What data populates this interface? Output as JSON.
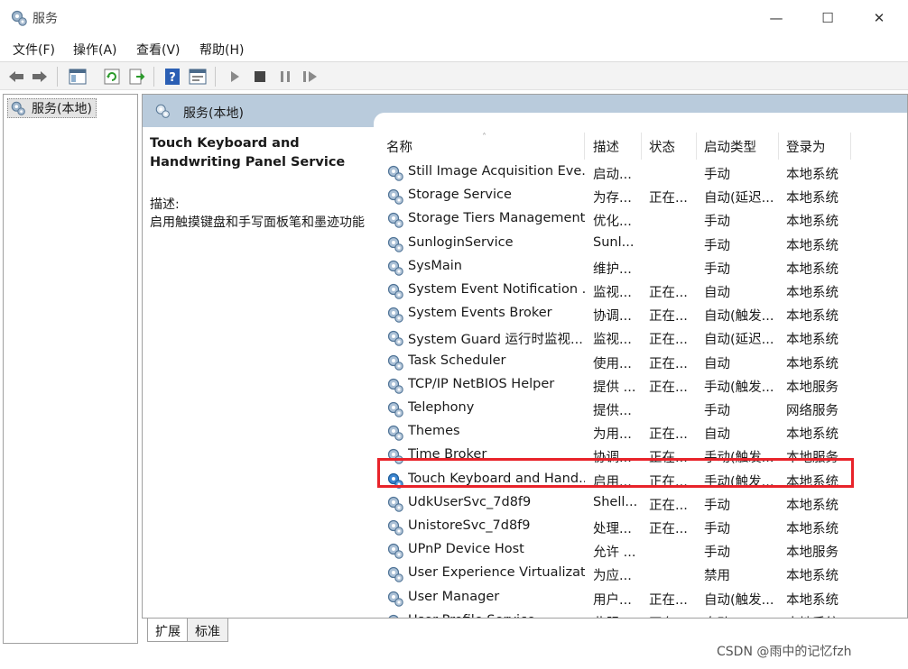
{
  "window": {
    "title": "服务",
    "min_glyph": "—",
    "max_glyph": "☐",
    "close_glyph": "✕"
  },
  "menu": {
    "items": [
      "文件(F)",
      "操作(A)",
      "查看(V)",
      "帮助(H)"
    ]
  },
  "tree": {
    "root_label": "服务(本地)"
  },
  "main": {
    "header_title": "服务(本地)"
  },
  "description": {
    "service_title": "Touch Keyboard and Handwriting Panel Service",
    "label": "描述:",
    "text": "启用触摸键盘和手写面板笔和墨迹功能"
  },
  "columns": [
    "名称",
    "描述",
    "状态",
    "启动类型",
    "登录为"
  ],
  "sort_indicator": "˄",
  "services": [
    {
      "name": "Still Image Acquisition Eve...",
      "desc": "启动...",
      "state": "",
      "startup": "手动",
      "logon": "本地系统"
    },
    {
      "name": "Storage Service",
      "desc": "为存...",
      "state": "正在...",
      "startup": "自动(延迟...",
      "logon": "本地系统"
    },
    {
      "name": "Storage Tiers Management",
      "desc": "优化...",
      "state": "",
      "startup": "手动",
      "logon": "本地系统"
    },
    {
      "name": "SunloginService",
      "desc": "Sunl...",
      "state": "",
      "startup": "手动",
      "logon": "本地系统"
    },
    {
      "name": "SysMain",
      "desc": "维护...",
      "state": "",
      "startup": "手动",
      "logon": "本地系统"
    },
    {
      "name": "System Event Notification ...",
      "desc": "监视...",
      "state": "正在...",
      "startup": "自动",
      "logon": "本地系统"
    },
    {
      "name": "System Events Broker",
      "desc": "协调...",
      "state": "正在...",
      "startup": "自动(触发...",
      "logon": "本地系统"
    },
    {
      "name": "System Guard 运行时监视...",
      "desc": "监视...",
      "state": "正在...",
      "startup": "自动(延迟...",
      "logon": "本地系统"
    },
    {
      "name": "Task Scheduler",
      "desc": "使用...",
      "state": "正在...",
      "startup": "自动",
      "logon": "本地系统"
    },
    {
      "name": "TCP/IP NetBIOS Helper",
      "desc": "提供 ...",
      "state": "正在...",
      "startup": "手动(触发...",
      "logon": "本地服务"
    },
    {
      "name": "Telephony",
      "desc": "提供...",
      "state": "",
      "startup": "手动",
      "logon": "网络服务"
    },
    {
      "name": "Themes",
      "desc": "为用...",
      "state": "正在...",
      "startup": "自动",
      "logon": "本地系统"
    },
    {
      "name": "Time Broker",
      "desc": "协调...",
      "state": "正在...",
      "startup": "手动(触发...",
      "logon": "本地服务"
    },
    {
      "name": "Touch Keyboard and Hand...",
      "desc": "启用...",
      "state": "正在...",
      "startup": "手动(触发...",
      "logon": "本地系统"
    },
    {
      "name": "UdkUserSvc_7d8f9",
      "desc": "Shell...",
      "state": "正在...",
      "startup": "手动",
      "logon": "本地系统"
    },
    {
      "name": "UnistoreSvc_7d8f9",
      "desc": "处理...",
      "state": "正在...",
      "startup": "手动",
      "logon": "本地系统"
    },
    {
      "name": "UPnP Device Host",
      "desc": "允许 ...",
      "state": "",
      "startup": "手动",
      "logon": "本地服务"
    },
    {
      "name": "User Experience Virtualizat...",
      "desc": "为应...",
      "state": "",
      "startup": "禁用",
      "logon": "本地系统"
    },
    {
      "name": "User Manager",
      "desc": "用户...",
      "state": "正在...",
      "startup": "自动(触发...",
      "logon": "本地系统"
    },
    {
      "name": "User Profile Service",
      "desc": "此服...",
      "state": "正在...",
      "startup": "自动",
      "logon": "本地系统"
    }
  ],
  "highlighted_index": 13,
  "tabs": [
    "扩展",
    "标准"
  ],
  "watermark": "CSDN @雨中的记忆fzh",
  "colors": {
    "header_band": "#b9cbdc",
    "highlight_border": "#e8232a"
  }
}
